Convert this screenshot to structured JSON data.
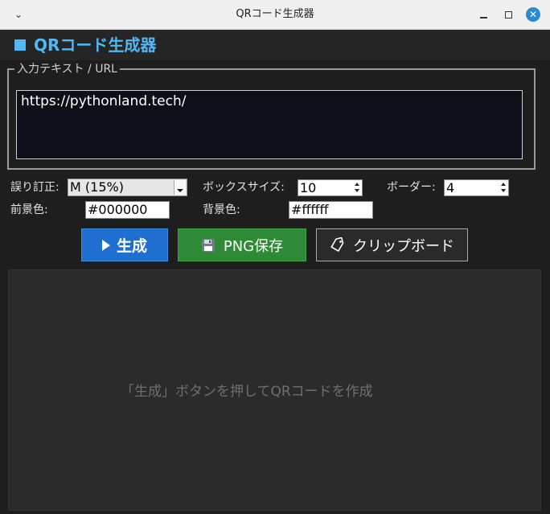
{
  "window": {
    "title": "QRコード生成器",
    "menu_icon": "chevron-down-icon",
    "min_icon": "minimize-icon",
    "max_icon": "maximize-icon",
    "close_icon": "close-icon",
    "close_glyph": "✕"
  },
  "header": {
    "title": "QRコード生成器",
    "accent_color": "#4fb8f5"
  },
  "input": {
    "legend": "入力テキスト / URL",
    "value": "https://pythonland.tech/"
  },
  "options": {
    "error_correction_label": "誤り訂正:",
    "error_correction_value": "M (15%)",
    "box_size_label": "ボックスサイズ:",
    "box_size_value": "10",
    "border_label": "ボーダー:",
    "border_value": "4",
    "fg_label": "前景色:",
    "fg_value": "#000000",
    "bg_label": "背景色:",
    "bg_value": "#ffffff"
  },
  "buttons": {
    "generate_label": "生成",
    "save_png_label": "PNG保存",
    "clipboard_label": "クリップボード",
    "generate_color": "#1f6fd0",
    "save_color": "#2f8a35"
  },
  "preview": {
    "placeholder": "「生成」ボタンを押してQRコードを作成"
  }
}
